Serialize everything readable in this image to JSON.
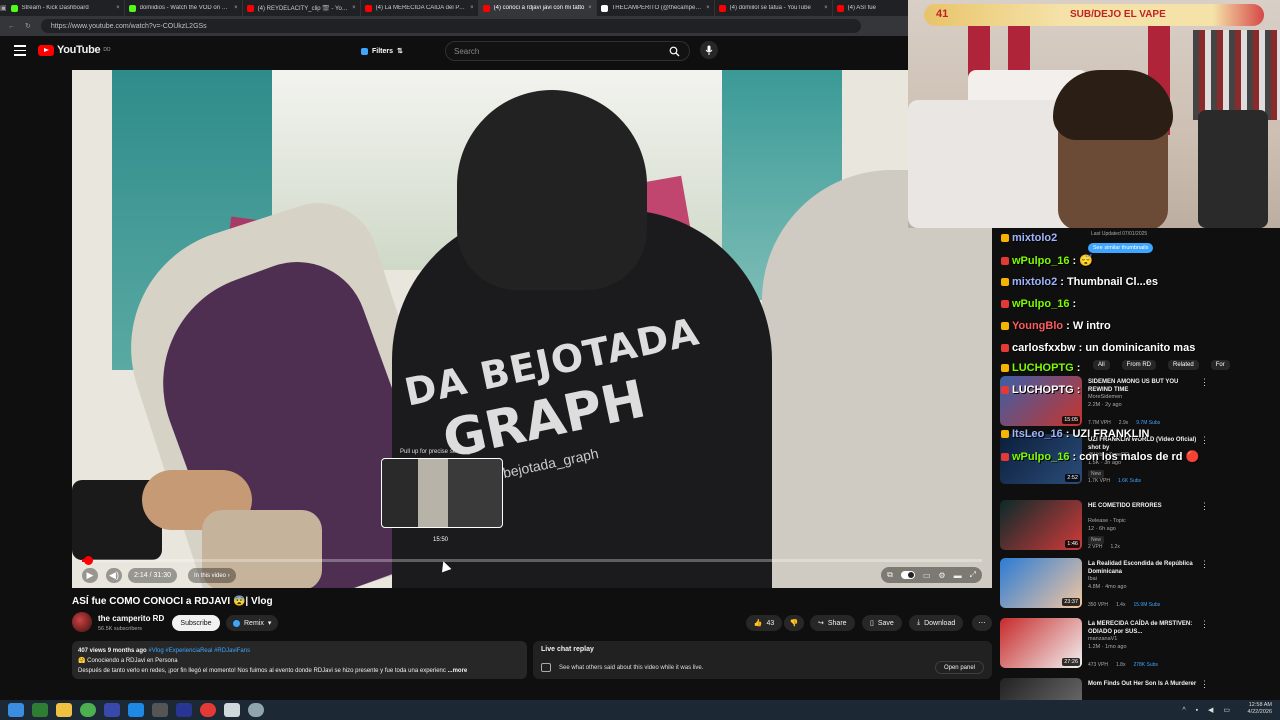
{
  "browser": {
    "tabs": [
      {
        "title": "Stream - Kick Dashboard",
        "color": "#53fc18",
        "active": false
      },
      {
        "title": "domiidios - Watch the VOD on Kick",
        "color": "#53fc18",
        "active": false
      },
      {
        "title": "(4) REYDELACITY_clip 🎬 - YouTube",
        "color": "#ff0000",
        "active": false
      },
      {
        "title": "(4) La MERECIDA CAÍDA del PADRE",
        "color": "#ff0000",
        "active": false
      },
      {
        "title": "(4) conoci a rdjavi javi con mi tatto",
        "color": "#ff0000",
        "active": true
      },
      {
        "title": "THECAMPERITO (@thecamperito)",
        "color": "#ffffff",
        "active": false
      },
      {
        "title": "(4) domiilol se tatua - YouTube",
        "color": "#ff0000",
        "active": false
      },
      {
        "title": "(4) ASI fue",
        "color": "#ff0000",
        "active": false
      }
    ],
    "url": "https://www.youtube.com/watch?v=-COUkzL2GSs"
  },
  "youtube": {
    "logo_text": "YouTube",
    "logo_sup": "DO",
    "filters_label": "Filters",
    "search_placeholder": "Search"
  },
  "player": {
    "seek_hint": "Pull up for precise seeking",
    "seek_time": "15:50",
    "current_time": "2:14 / 31:30",
    "chapter": "In this video",
    "progress": 0.007,
    "hover_position": 0.4
  },
  "video_art": {
    "print1": "DA BEJOTADA",
    "print2": "GRAPH",
    "print3": "bejotada_graph"
  },
  "video_info": {
    "title": "ASÍ fue COMO CONOCI a RDJAVI 😨| Vlog",
    "channel": "the camperito RD",
    "subscribers": "56.5K subscribers",
    "subscribe_label": "Subscribe",
    "remix_label": "Remix",
    "likes": "43",
    "share_label": "Share",
    "save_label": "Save",
    "download_label": "Download",
    "desc_meta": "407 views  9 months ago",
    "desc_tags": "#Vlog #ExperienciaReal #RDJaviFans",
    "desc_line2": "🤗 Conociendo a RDJavi en Persona",
    "desc_line3": "Después de tanto verlo en redes, ¡por fin llegó el momento! Nos fuimos al evento donde RDJavi se hizo presente y fue toda una experienc",
    "desc_more": "...more"
  },
  "chat_replay": {
    "title": "Live chat replay",
    "description": "See what others said about this video while it was live.",
    "button": "Open panel"
  },
  "webcam": {
    "sub_count": "41",
    "sub_text": "SUB/DEJO EL VAPE"
  },
  "sidebar": {
    "last_updated": "Last Updated 07/01/2025",
    "similar_label": "See similar thumbnails",
    "tabs": [
      "All",
      "From RD",
      "Related",
      "For"
    ],
    "recs": [
      {
        "title": "SIDEMEN AMONG US BUT YOU REWIND TIME",
        "channel": "MoreSidemen",
        "stats": "2.2M · 2y ago",
        "duration": "15:05",
        "badge": "",
        "m1": "7.7M VPH",
        "m2": "2.9x",
        "m3": "9.7M Subs"
      },
      {
        "title": "UZI  FRANKLIN WORLD (Video Oficial) shot by",
        "channel": "@UrbanZoneRD",
        "stats": "1.5K · 3h ago",
        "duration": "2:52",
        "badge": "New",
        "m1": "1.7K VPH",
        "m2": "",
        "m3": "1.6K Subs"
      },
      {
        "title": "HE COMETIDO ERRORES",
        "channel": "Release - Topic",
        "stats": "12 · 6h ago",
        "duration": "1:46",
        "badge": "New",
        "m1": "2 VPH",
        "m2": "1.2x",
        "m3": ""
      },
      {
        "title": "La Realidad Escondida de República Dominicana",
        "channel": "Ibai",
        "stats": "4.8M · 4mo ago",
        "duration": "23:37",
        "badge": "",
        "m1": "350 VPH",
        "m2": "1.4x",
        "m3": "15.9M Subs"
      },
      {
        "title": "La MERECIDA CAÍDA de MRSTIVEN: ODIADO por SUS...",
        "channel": "manzanaV1",
        "stats": "1.2M · 1mo ago",
        "duration": "27:26",
        "badge": "",
        "m1": "473 VPH",
        "m2": "1.8x",
        "m3": "278K Subs"
      },
      {
        "title": "Mom Finds Out Her Son Is A Murderer",
        "channel": "",
        "stats": "",
        "duration": "",
        "badge": "",
        "m1": "",
        "m2": "",
        "m3": ""
      }
    ],
    "chat": [
      {
        "user": "mixtolo2",
        "msg": "",
        "color": "#9fb6ff"
      },
      {
        "user": "wPulpo_16",
        "msg": ": 😴",
        "color": "#7cfc00"
      },
      {
        "user": "mixtolo2",
        "msg": ": Thumbnail Cl...es",
        "color": "#9fb6ff"
      },
      {
        "user": "wPulpo_16",
        "msg": ":",
        "color": "#7cfc00"
      },
      {
        "user": "YoungBlo",
        "msg": ": W intro",
        "color": "#ff5d5d"
      },
      {
        "user": "carlosfxxbw",
        "msg": ": un dominicanito mas",
        "color": "#ffffff"
      },
      {
        "user": "LUCHOPTG",
        "msg": ":",
        "color": "#7cfc00"
      },
      {
        "user": "LUCHOPTG",
        "msg": ":",
        "color": "#ffffff"
      },
      {
        "user": "ItsLeo_16",
        "msg": ": UZI  FRANKLIN",
        "color": "#9fb6ff"
      },
      {
        "user": "wPulpo_16",
        "msg": ": con los malos de rd 🔴",
        "color": "#7cfc00"
      }
    ]
  },
  "taskbar": {
    "time": "12:58 AM",
    "date": "4/22/2026",
    "tray": "^ ▪ ◀ ▭"
  }
}
